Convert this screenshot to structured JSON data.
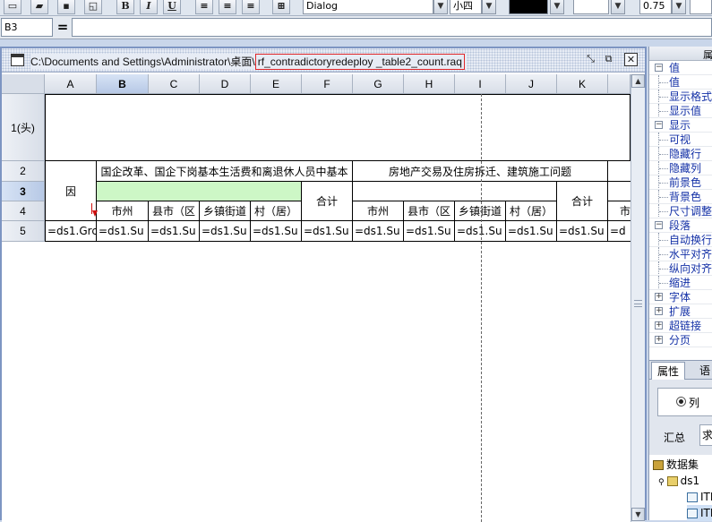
{
  "toolbar": {
    "bold": "B",
    "italic": "I",
    "underline": "U",
    "font_name": "Dialog",
    "font_size": "小四",
    "zoom": "0.75"
  },
  "formula_bar": {
    "cell_ref": "B3",
    "equals_label": "=",
    "formula": ""
  },
  "doc_window": {
    "path_prefix": "C:\\Documents and Settings\\Administrator\\桌面\\",
    "file_name": "rf_contradictoryredeploy _table2_count.raq"
  },
  "grid": {
    "columns": [
      "A",
      "B",
      "C",
      "D",
      "E",
      "F",
      "G",
      "H",
      "I",
      "J",
      "K",
      ""
    ],
    "selected_column": "B",
    "rows": [
      "1(头)",
      "2",
      "3",
      "4",
      "5"
    ],
    "selected_row": "3",
    "cells": {
      "A2_merged": "因",
      "B2_group": "国企改革、国企下岗基本生活费和离退休人员中基本",
      "F_total_1": "合计",
      "G2_group": "房地产交易及住房拆迁、建筑施工问题",
      "K_total_2": "合计",
      "row4_B": "市州",
      "row4_C": "县市（区",
      "row4_D": "乡镇街道",
      "row4_E": "村（居）",
      "row4_G": "市州",
      "row4_H": "县市（区",
      "row4_I": "乡镇街道",
      "row4_J": "村（居）",
      "row4_L": "市",
      "row5_A": "=ds1.Grc",
      "row5_B": "=ds1.Su",
      "row5_C": "=ds1.Su",
      "row5_D": "=ds1.Su",
      "row5_E": "=ds1.Su",
      "row5_F": "=ds1.Su",
      "row5_G": "=ds1.Su",
      "row5_H": "=ds1.Su",
      "row5_I": "=ds1.Su",
      "row5_J": "=ds1.Su",
      "row5_K": "=ds1.Su",
      "row5_L": "=d"
    }
  },
  "property_panel": {
    "header": "属",
    "items": [
      {
        "label": "值",
        "type": "category",
        "toggle": "−"
      },
      {
        "label": "值",
        "type": "leaf"
      },
      {
        "label": "显示格式",
        "type": "leaf"
      },
      {
        "label": "显示值",
        "type": "leaf"
      },
      {
        "label": "显示",
        "type": "category",
        "toggle": "−"
      },
      {
        "label": "可视",
        "type": "leaf"
      },
      {
        "label": "隐藏行",
        "type": "leaf"
      },
      {
        "label": "隐藏列",
        "type": "leaf"
      },
      {
        "label": "前景色",
        "type": "leaf"
      },
      {
        "label": "背景色",
        "type": "leaf"
      },
      {
        "label": "尺寸调整",
        "type": "leaf"
      },
      {
        "label": "段落",
        "type": "category",
        "toggle": "−"
      },
      {
        "label": "自动换行",
        "type": "leaf"
      },
      {
        "label": "水平对齐",
        "type": "leaf"
      },
      {
        "label": "纵向对齐",
        "type": "leaf"
      },
      {
        "label": "缩进",
        "type": "leaf"
      },
      {
        "label": "字体",
        "type": "category",
        "toggle": "+"
      },
      {
        "label": "扩展",
        "type": "category",
        "toggle": "+"
      },
      {
        "label": "超链接",
        "type": "category",
        "toggle": "+"
      },
      {
        "label": "分页",
        "type": "category",
        "toggle": "+"
      }
    ],
    "tabs": [
      "属性",
      "语"
    ],
    "radio_label": "列",
    "summary_label": "汇总",
    "summary_value": "求",
    "datasets": {
      "root": "数据集",
      "ds": "ds1",
      "fields": [
        "ITI",
        "ITI"
      ]
    }
  }
}
